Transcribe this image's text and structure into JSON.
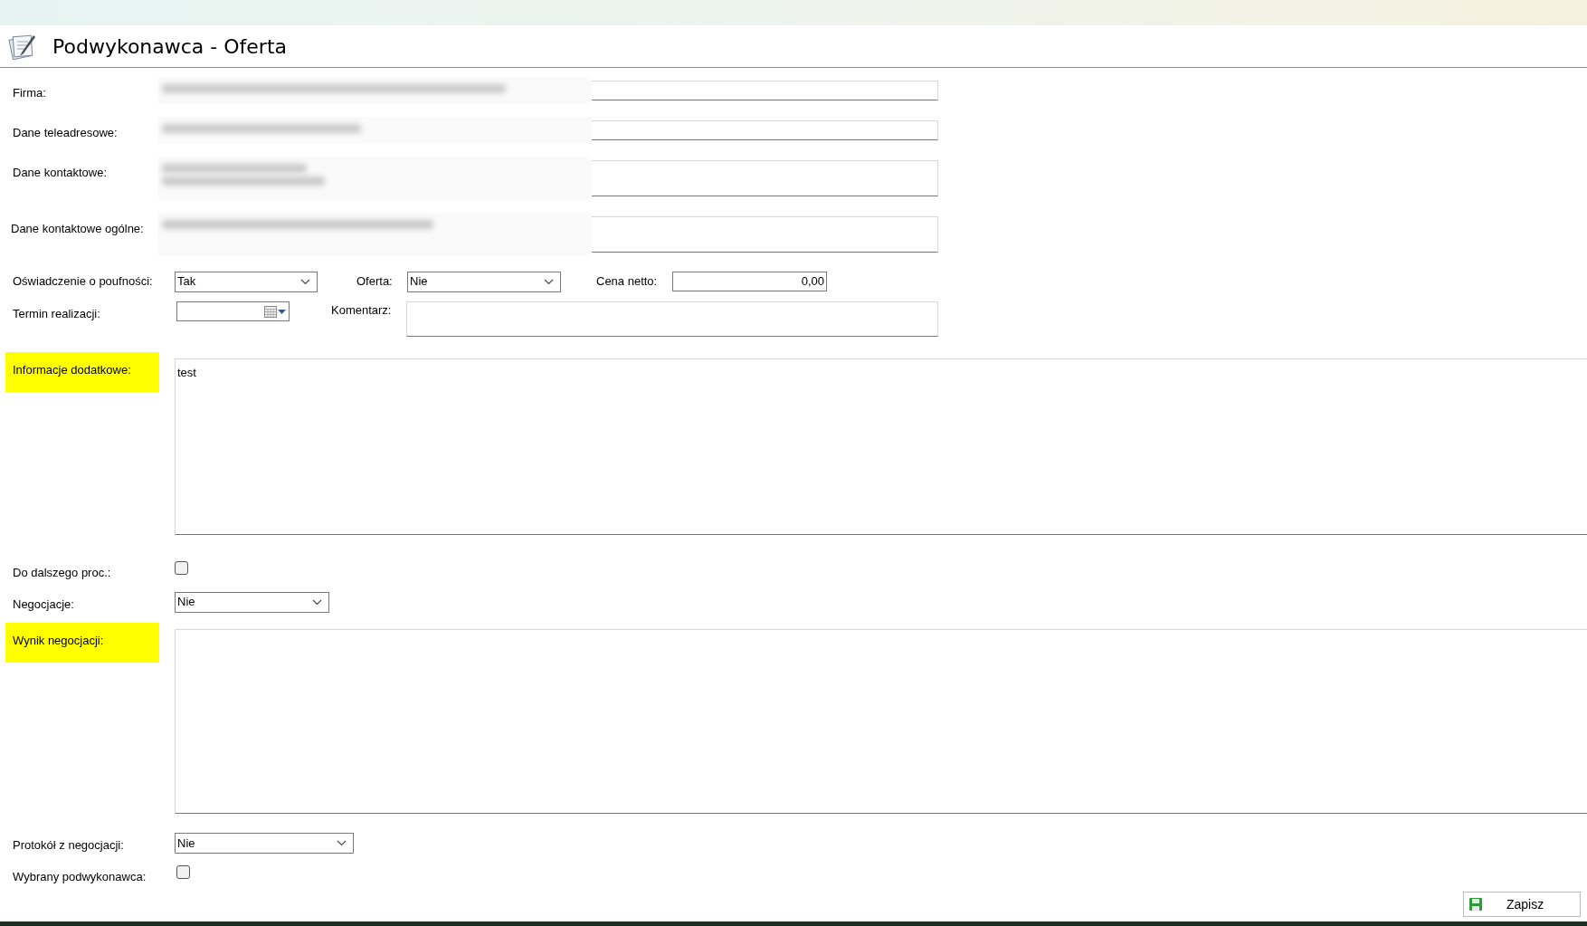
{
  "header": {
    "title": "Podwykonawca - Oferta"
  },
  "contact_fields": [
    {
      "label": "Firma:",
      "kind": "line"
    },
    {
      "label": "Dane teleadresowe:",
      "kind": "line"
    },
    {
      "label": "Dane kontaktowe:",
      "kind": "multi"
    },
    {
      "label": "Dane kontaktowe ogólne:",
      "kind": "multi"
    }
  ],
  "row_1": [
    {
      "kind": "select",
      "label": "Oświadczenie o poufności:",
      "value": "Tak"
    },
    {
      "kind": "select",
      "label": "Oferta:",
      "value": "Nie"
    },
    {
      "kind": "number",
      "label": "Cena netto:",
      "value": "0,00"
    }
  ],
  "row_2": [
    {
      "kind": "date",
      "label": "Termin realizacji:"
    },
    {
      "kind": "textarea",
      "label": "Komentarz:"
    }
  ],
  "sections": [
    {
      "kind": "textarea",
      "label": "Informacje dodatkowe:",
      "highlighted": true,
      "value": "test"
    },
    {
      "kind": "checkbox",
      "label": "Do dalszego proc.:",
      "highlighted": false,
      "checked": false
    },
    {
      "kind": "select",
      "label": "Negocjacje:",
      "highlighted": false,
      "value": "Nie"
    },
    {
      "kind": "textarea",
      "label": "Wynik negocjacji:",
      "highlighted": true
    },
    {
      "kind": "select",
      "label": "Protokół z negocjacji:",
      "highlighted": false,
      "value": "Nie"
    },
    {
      "kind": "checkbox",
      "label": "Wybrany podwykonawca:",
      "highlighted": false,
      "checked": false
    }
  ],
  "buttons": [
    {
      "label": "Zapisz"
    }
  ]
}
